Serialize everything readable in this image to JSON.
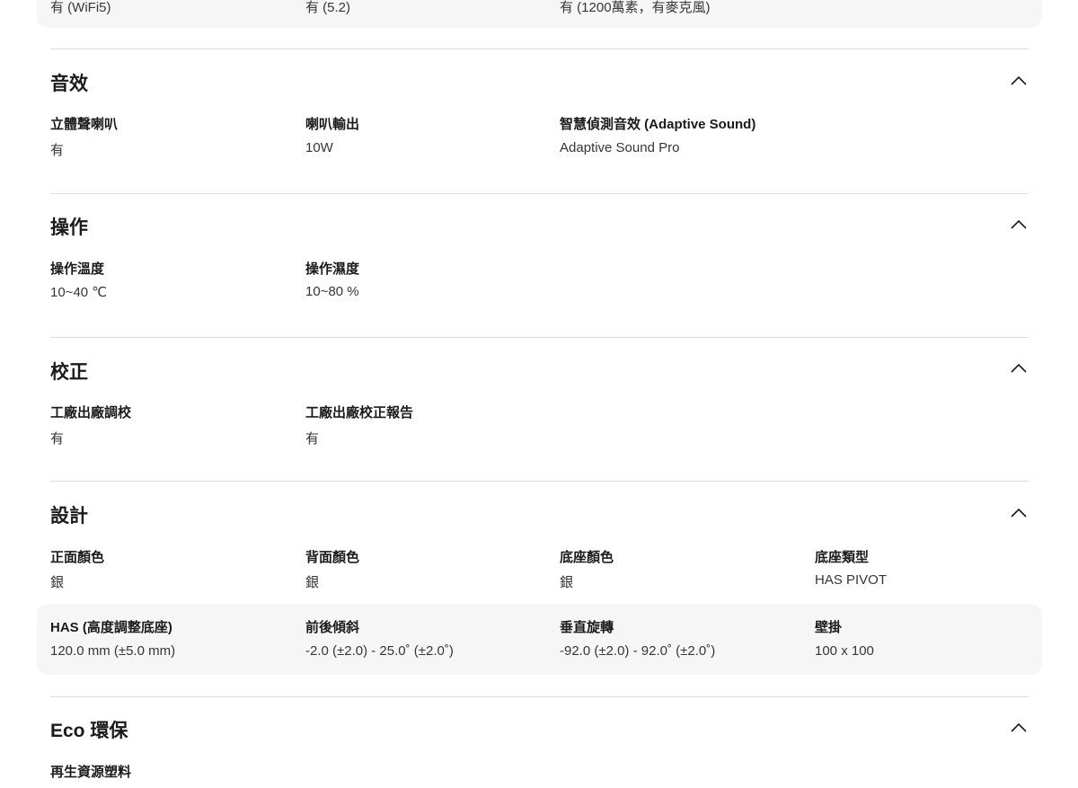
{
  "connectivity_tail": {
    "values": [
      "有 (WiFi5)",
      "有 (5.2)",
      "有 (1200萬素，有麥克風)"
    ]
  },
  "sections": {
    "sound": {
      "title": "音效",
      "rows": [
        [
          {
            "label": "立體聲喇叭",
            "value": "有"
          },
          {
            "label": "喇叭輸出",
            "value": "10W"
          },
          {
            "label": "智慧偵測音效 (Adaptive Sound)",
            "value": "Adaptive Sound Pro"
          }
        ]
      ]
    },
    "operation": {
      "title": "操作",
      "rows": [
        [
          {
            "label": "操作溫度",
            "value": "10~40 ℃"
          },
          {
            "label": "操作濕度",
            "value": "10~80 %"
          }
        ]
      ]
    },
    "calibration": {
      "title": "校正",
      "rows": [
        [
          {
            "label": "工廠出廠調校",
            "value": "有"
          },
          {
            "label": "工廠出廠校正報告",
            "value": "有"
          }
        ]
      ]
    },
    "design": {
      "title": "設計",
      "rows": [
        [
          {
            "label": "正面顏色",
            "value": "銀"
          },
          {
            "label": "背面顏色",
            "value": "銀"
          },
          {
            "label": "底座顏色",
            "value": "銀"
          },
          {
            "label": "底座類型",
            "value": "HAS PIVOT"
          }
        ],
        [
          {
            "label": "HAS (高度調整底座)",
            "value": "120.0 mm (±5.0 mm)"
          },
          {
            "label": "前後傾斜",
            "value": "-2.0 (±2.0) - 25.0˚ (±2.0˚)"
          },
          {
            "label": "垂直旋轉",
            "value": "-92.0 (±2.0) - 92.0˚ (±2.0˚)"
          },
          {
            "label": "壁掛",
            "value": "100 x 100"
          }
        ]
      ]
    },
    "eco": {
      "title": "Eco 環保",
      "rows": [
        [
          {
            "label": "再生資源塑料"
          }
        ]
      ]
    }
  },
  "icons": {
    "toggle": "chevron-up-icon"
  },
  "colors": {
    "text": "#1b1b1b",
    "value_text": "#363636",
    "band_background": "#f6f6f6",
    "divider": "#dddddd"
  }
}
